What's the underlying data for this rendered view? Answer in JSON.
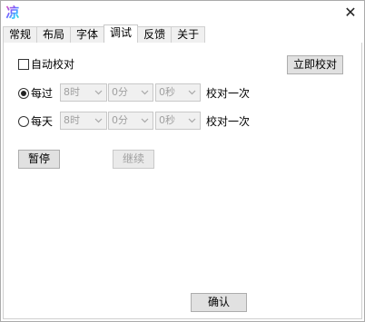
{
  "titlebar": {
    "close_glyph": "✕",
    "icon_glyph": "凉"
  },
  "tabs": [
    {
      "label": "常规"
    },
    {
      "label": "布局"
    },
    {
      "label": "字体"
    },
    {
      "label": "调试",
      "active": true
    },
    {
      "label": "反馈"
    },
    {
      "label": "关于"
    }
  ],
  "debug": {
    "auto_calibrate_label": "自动校对",
    "auto_calibrate_checked": false,
    "calibrate_now_label": "立即校对",
    "every": {
      "label": "每过",
      "selected": true,
      "hour": "8时",
      "minute": "0分",
      "second": "0秒",
      "suffix": "校对一次"
    },
    "daily": {
      "label": "每天",
      "selected": false,
      "hour": "8时",
      "minute": "0分",
      "second": "0秒",
      "suffix": "校对一次"
    },
    "pause_label": "暂停",
    "resume_label": "继续"
  },
  "footer": {
    "confirm_label": "确认"
  },
  "colors": {
    "button_bg": "#e1e1e1",
    "disabled_text": "#a0a0a0",
    "border": "#adadad"
  }
}
